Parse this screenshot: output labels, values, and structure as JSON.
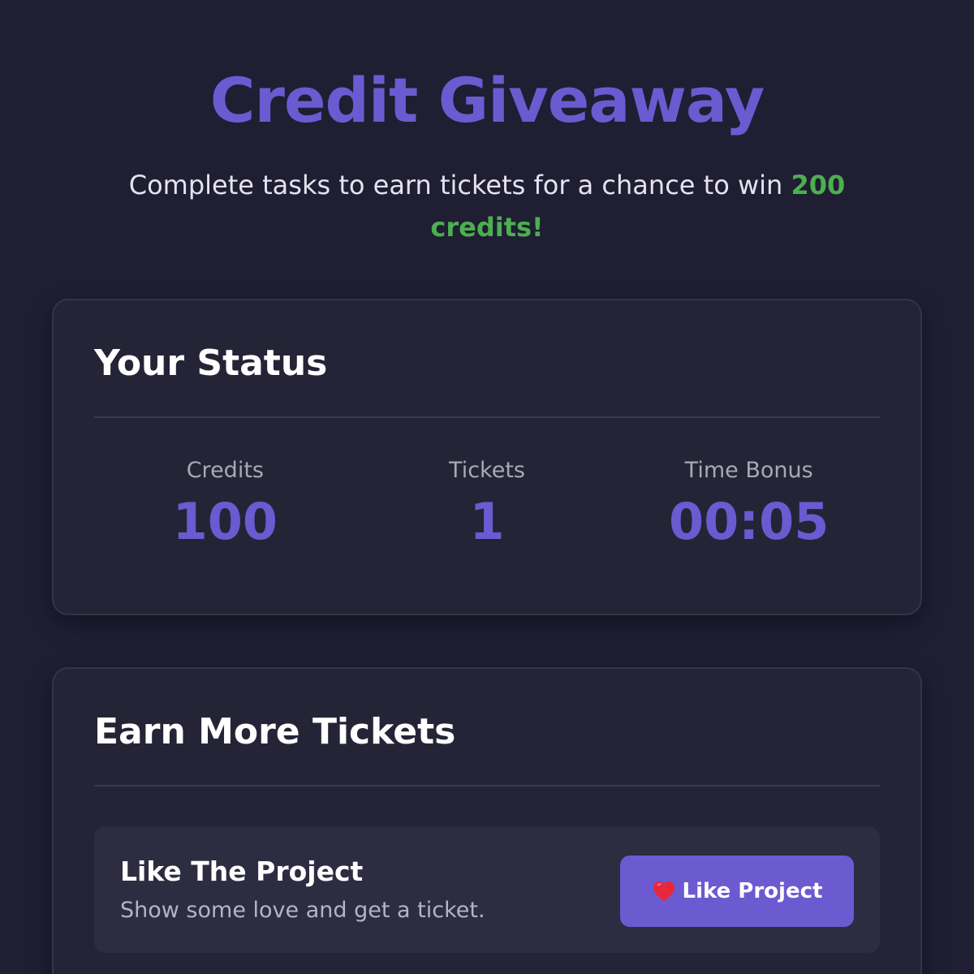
{
  "hero": {
    "title": "Credit Giveaway",
    "subtitle_prefix": "Complete tasks to earn tickets for a chance to win ",
    "subtitle_highlight": "200 credits!"
  },
  "status": {
    "title": "Your Status",
    "stats": [
      {
        "label": "Credits",
        "value": "100"
      },
      {
        "label": "Tickets",
        "value": "1"
      },
      {
        "label": "Time Bonus",
        "value": "00:05"
      }
    ]
  },
  "earn": {
    "title": "Earn More Tickets",
    "tasks": [
      {
        "title": "Like The Project",
        "description": "Show some love and get a ticket.",
        "button_label": "Like Project",
        "button_icon": "heart-icon"
      }
    ]
  },
  "colors": {
    "background": "#1f1e33",
    "accent": "#6c5ad1",
    "highlight": "#4caf50",
    "card": "#252437",
    "heart": "#e8283a"
  }
}
